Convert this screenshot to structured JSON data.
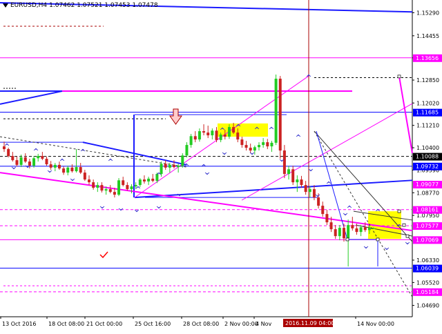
{
  "header": {
    "symbol": "EURUSD,H4",
    "ohlc": "1.07462 1.07521 1.07453 1.07478"
  },
  "colors": {
    "background": "#ffffff",
    "bull": "#22cc22",
    "bear": "#cc2222",
    "blue_line": "#1a1aff",
    "magenta_line": "#ff00ff",
    "dark_red": "#aa0000",
    "yellow_box": "#ffff00",
    "label_bg": "#0000ff"
  },
  "price_scale": {
    "ticks": [
      "1.15290",
      "1.14455",
      "1.13656",
      "1.12850",
      "1.12020",
      "1.11210",
      "1.10400",
      "1.09590",
      "1.08770",
      "1.07950",
      "1.06330",
      "1.05520",
      "1.04690"
    ],
    "labels": [
      {
        "text": "1.13656",
        "bg": "#ff00ff"
      },
      {
        "text": "1.11685",
        "bg": "#0000ff"
      },
      {
        "text": "1.10088",
        "bg": "#000000"
      },
      {
        "text": "1.09732",
        "bg": "#0000ff"
      },
      {
        "text": "1.09077",
        "bg": "#ff00ff"
      },
      {
        "text": "1.08161",
        "bg": "#ff00ff"
      },
      {
        "text": "1.07577",
        "bg": "#ff00ff"
      },
      {
        "text": "1.07069",
        "bg": "#ff00ff"
      },
      {
        "text": "1.06039",
        "bg": "#0000ff"
      },
      {
        "text": "1.05184",
        "bg": "#ff00ff"
      }
    ]
  },
  "time_scale": {
    "ticks": [
      "13 Oct 2016",
      "18 Oct 08:00",
      "21 Oct 00:00",
      "25 Oct 16:00",
      "28 Oct 08:00",
      "2 Nov 00:00",
      "4 Nov",
      "14 Nov 00:00"
    ],
    "cursor_label": "2016.11.09 04:00"
  },
  "chart_data": {
    "type": "candlestick",
    "symbol": "EURUSD",
    "timeframe": "H4",
    "xlabel": "",
    "ylabel": "",
    "ylim": [
      1.0428,
      1.1575
    ],
    "bars": [
      [
        1.1045,
        1.1062,
        1.1025,
        1.1035
      ],
      [
        1.1035,
        1.104,
        1.1005,
        1.101
      ],
      [
        1.101,
        1.1025,
        1.099,
        1.0995
      ],
      [
        1.0995,
        1.1008,
        1.0972,
        1.0978
      ],
      [
        1.0978,
        1.1015,
        1.097,
        1.1005
      ],
      [
        1.1005,
        1.102,
        1.0985,
        1.099
      ],
      [
        1.099,
        1.1,
        1.0965,
        1.0975
      ],
      [
        1.0975,
        1.101,
        1.0968,
        1.1002
      ],
      [
        1.1002,
        1.1018,
        1.099,
        1.101
      ],
      [
        1.101,
        1.1025,
        1.0995,
        1.1
      ],
      [
        1.1,
        1.1008,
        1.0975,
        1.098
      ],
      [
        1.098,
        1.0992,
        1.096,
        1.0968
      ],
      [
        1.0968,
        1.0985,
        1.0955,
        1.0978
      ],
      [
        1.0978,
        1.099,
        1.096,
        1.0965
      ],
      [
        1.0965,
        1.0972,
        1.0942,
        1.095
      ],
      [
        1.095,
        1.0975,
        1.094,
        1.0968
      ],
      [
        1.0968,
        1.098,
        1.095,
        1.0955
      ],
      [
        1.0955,
        1.1035,
        1.095,
        1.097
      ],
      [
        1.097,
        1.0985,
        1.0945,
        1.095
      ],
      [
        1.095,
        1.096,
        1.092,
        1.0925
      ],
      [
        1.0925,
        1.094,
        1.0905,
        1.0915
      ],
      [
        1.0915,
        1.0925,
        1.0888,
        1.0895
      ],
      [
        1.0895,
        1.0915,
        1.088,
        1.0905
      ],
      [
        1.0905,
        1.0915,
        1.0878,
        1.0885
      ],
      [
        1.0885,
        1.09,
        1.087,
        1.089
      ],
      [
        1.089,
        1.0905,
        1.0875,
        1.088
      ],
      [
        1.088,
        1.0895,
        1.086,
        1.087
      ],
      [
        1.087,
        1.093,
        1.0865,
        1.0922
      ],
      [
        1.0922,
        1.0935,
        1.09,
        1.0905
      ],
      [
        1.0905,
        1.0915,
        1.0885,
        1.089
      ],
      [
        1.089,
        1.0908,
        1.0875,
        1.09
      ],
      [
        1.09,
        1.0915,
        1.089,
        1.0905
      ],
      [
        1.0905,
        1.093,
        1.0898,
        1.0925
      ],
      [
        1.0925,
        1.094,
        1.091,
        1.0918
      ],
      [
        1.0918,
        1.0935,
        1.0905,
        1.0928
      ],
      [
        1.0928,
        1.0945,
        1.0915,
        1.092
      ],
      [
        1.092,
        1.095,
        1.0912,
        1.0945
      ],
      [
        1.0945,
        1.099,
        1.0935,
        1.0982
      ],
      [
        1.0982,
        1.0995,
        1.096,
        1.0968
      ],
      [
        1.0968,
        1.0985,
        1.095,
        1.0978
      ],
      [
        1.0978,
        1.0995,
        1.0965,
        1.097
      ],
      [
        1.097,
        1.0982,
        1.095,
        1.0975
      ],
      [
        1.0975,
        1.102,
        1.0968,
        1.1012
      ],
      [
        1.1012,
        1.106,
        1.1005,
        1.105
      ],
      [
        1.105,
        1.109,
        1.104,
        1.1082
      ],
      [
        1.1082,
        1.11,
        1.106,
        1.107
      ],
      [
        1.107,
        1.111,
        1.1062,
        1.11
      ],
      [
        1.11,
        1.1125,
        1.1085,
        1.1095
      ],
      [
        1.1095,
        1.112,
        1.1075,
        1.1085
      ],
      [
        1.1085,
        1.111,
        1.107,
        1.1102
      ],
      [
        1.1102,
        1.1115,
        1.106,
        1.1068
      ],
      [
        1.1068,
        1.1095,
        1.106,
        1.1088
      ],
      [
        1.1088,
        1.1105,
        1.107,
        1.108
      ],
      [
        1.108,
        1.1125,
        1.1072,
        1.1115
      ],
      [
        1.1115,
        1.113,
        1.109,
        1.1095
      ],
      [
        1.1095,
        1.111,
        1.106,
        1.107
      ],
      [
        1.107,
        1.108,
        1.104,
        1.105
      ],
      [
        1.105,
        1.1065,
        1.103,
        1.104
      ],
      [
        1.104,
        1.1055,
        1.102,
        1.103
      ],
      [
        1.103,
        1.1048,
        1.1015,
        1.1042
      ],
      [
        1.1042,
        1.106,
        1.103,
        1.105
      ],
      [
        1.105,
        1.1075,
        1.104,
        1.106
      ],
      [
        1.106,
        1.1072,
        1.1035,
        1.1045
      ],
      [
        1.1045,
        1.1065,
        1.1025,
        1.1058
      ],
      [
        1.1058,
        1.1305,
        1.105,
        1.129
      ],
      [
        1.129,
        1.13,
        1.1,
        1.103
      ],
      [
        1.103,
        1.105,
        1.093,
        1.0945
      ],
      [
        1.0945,
        1.0975,
        1.0925,
        1.0962
      ],
      [
        1.0962,
        1.0975,
        1.0905,
        1.0915
      ],
      [
        1.0915,
        1.094,
        1.088,
        1.0925
      ],
      [
        1.0925,
        1.0938,
        1.0895,
        1.0905
      ],
      [
        1.0905,
        1.092,
        1.087,
        1.088
      ],
      [
        1.088,
        1.09,
        1.086,
        1.089
      ],
      [
        1.089,
        1.0905,
        1.085,
        1.086
      ],
      [
        1.086,
        1.0875,
        1.082,
        1.083
      ],
      [
        1.083,
        1.0845,
        1.079,
        1.08
      ],
      [
        1.08,
        1.0815,
        1.076,
        1.077
      ],
      [
        1.077,
        1.079,
        1.0735,
        1.0745
      ],
      [
        1.0745,
        1.076,
        1.071,
        1.072
      ],
      [
        1.072,
        1.076,
        1.0705,
        1.075
      ],
      [
        1.075,
        1.0765,
        1.07,
        1.0712
      ],
      [
        1.0712,
        1.078,
        1.061,
        1.076
      ],
      [
        1.076,
        1.079,
        1.074,
        1.0748
      ],
      [
        1.0748,
        1.0765,
        1.0725,
        1.0735
      ],
      [
        1.0735,
        1.076,
        1.072,
        1.0752
      ],
      [
        1.0752,
        1.077,
        1.0735,
        1.0742
      ],
      [
        1.0742,
        1.076,
        1.0728,
        1.075
      ],
      [
        1.0746,
        1.0752,
        1.0745,
        1.0748
      ]
    ],
    "horizontal_levels": [
      {
        "price": 1.13656,
        "color": "#ff00ff",
        "style": "solid"
      },
      {
        "price": 1.11685,
        "color": "#0000ff",
        "style": "solid"
      },
      {
        "price": 1.10088,
        "color": "#000000",
        "style": "dash"
      },
      {
        "price": 1.09732,
        "color": "#0000ff",
        "style": "solid"
      },
      {
        "price": 1.08161,
        "color": "#ff00ff",
        "style": "dash"
      },
      {
        "price": 1.07577,
        "color": "#ff00ff",
        "style": "dash"
      },
      {
        "price": 1.07069,
        "color": "#ff00ff",
        "style": "solid"
      },
      {
        "price": 1.06039,
        "color": "#0000ff",
        "style": "solid"
      },
      {
        "price": 1.05184,
        "color": "#ff00ff",
        "style": "dash"
      }
    ],
    "grid": false,
    "legend": "none"
  }
}
